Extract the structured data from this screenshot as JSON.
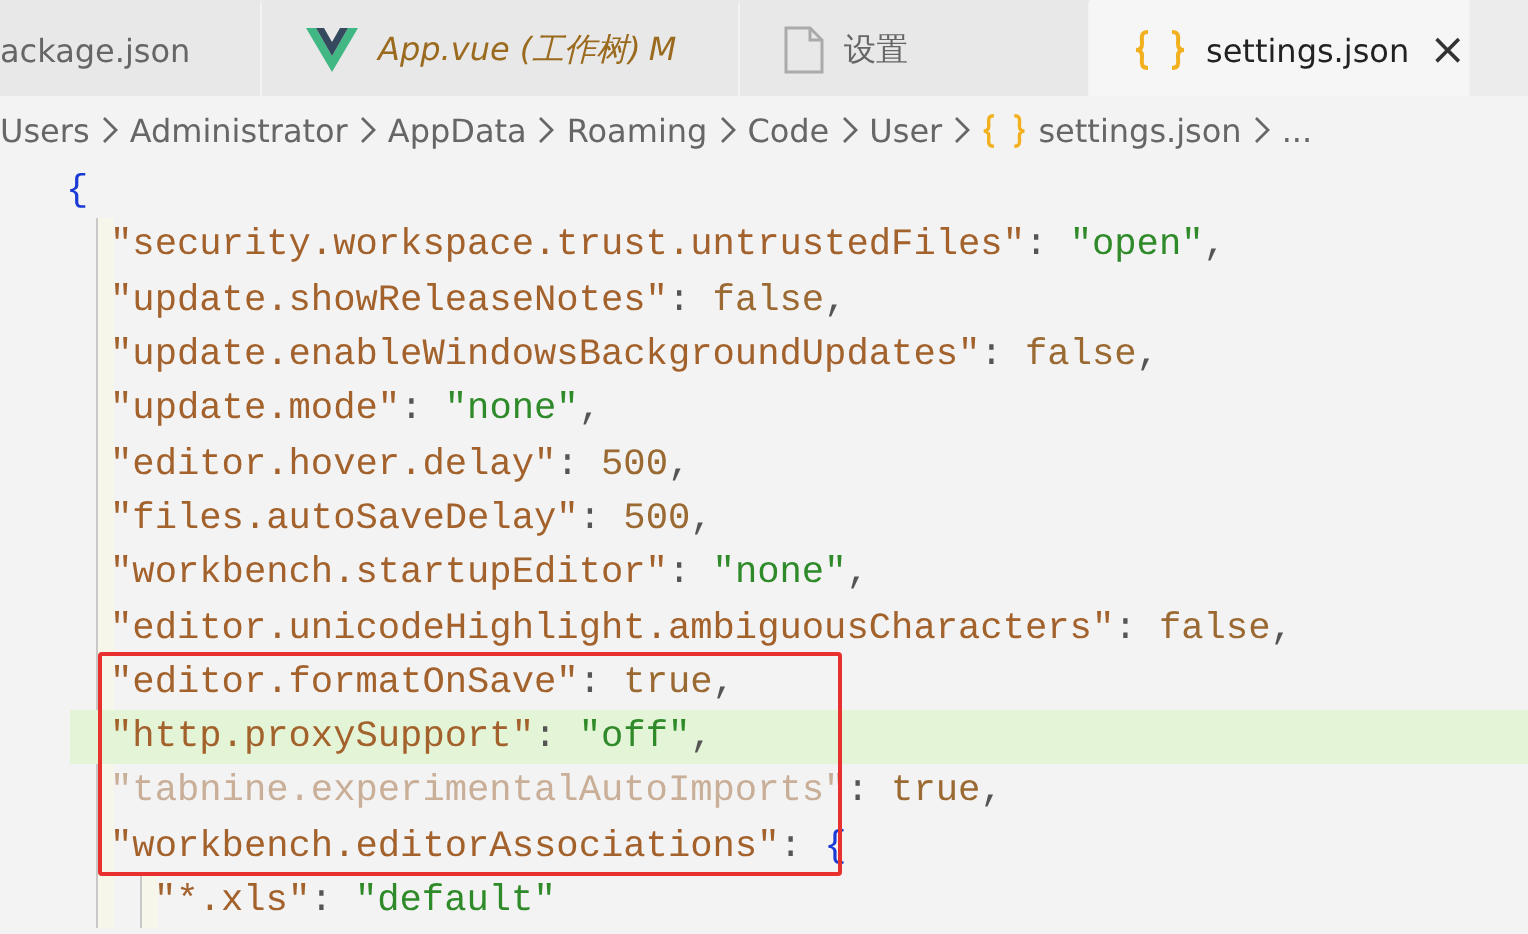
{
  "tabs": [
    {
      "kind": "json",
      "label": "ackage.json",
      "selected": false,
      "modified": false
    },
    {
      "kind": "vue",
      "label": "App.vue (工作树)",
      "decoration": "M",
      "selected": false,
      "modified": true
    },
    {
      "kind": "file",
      "label": "设置",
      "selected": false,
      "modified": false
    },
    {
      "kind": "settings",
      "label": "settings.json",
      "close": "×",
      "selected": true,
      "modified": false
    }
  ],
  "breadcrumbs": [
    {
      "kind": "folder",
      "label": "Users"
    },
    {
      "kind": "folder",
      "label": "Administrator"
    },
    {
      "kind": "folder",
      "label": "AppData"
    },
    {
      "kind": "folder",
      "label": "Roaming"
    },
    {
      "kind": "folder",
      "label": "Code"
    },
    {
      "kind": "folder",
      "label": "User"
    },
    {
      "kind": "json",
      "label": "settings.json"
    },
    {
      "kind": "more",
      "label": "..."
    }
  ],
  "code": {
    "highlighted": false,
    "boxed": false,
    "tokens": [
      {
        "kind": "brace",
        "text": "{"
      }
    ],
    "children": [
      {
        "highlighted": false,
        "boxed": false,
        "tokens": [
          {
            "kind": "key",
            "text": "\"security.workspace.trust.untrustedFiles\""
          },
          {
            "kind": "punct",
            "text": ": "
          },
          {
            "kind": "string",
            "text": "\"open\""
          },
          {
            "kind": "punct",
            "text": ","
          }
        ]
      },
      {
        "highlighted": false,
        "boxed": false,
        "tokens": [
          {
            "kind": "key",
            "text": "\"update.showReleaseNotes\""
          },
          {
            "kind": "punct",
            "text": ": "
          },
          {
            "kind": "literal",
            "text": "false"
          },
          {
            "kind": "punct",
            "text": ","
          }
        ]
      },
      {
        "highlighted": false,
        "boxed": false,
        "tokens": [
          {
            "kind": "key",
            "text": "\"update.enableWindowsBackgroundUpdates\""
          },
          {
            "kind": "punct",
            "text": ": "
          },
          {
            "kind": "literal",
            "text": "false"
          },
          {
            "kind": "punct",
            "text": ","
          }
        ]
      },
      {
        "highlighted": false,
        "boxed": false,
        "tokens": [
          {
            "kind": "key",
            "text": "\"update.mode\""
          },
          {
            "kind": "punct",
            "text": ": "
          },
          {
            "kind": "string",
            "text": "\"none\""
          },
          {
            "kind": "punct",
            "text": ","
          }
        ]
      },
      {
        "highlighted": false,
        "boxed": false,
        "tokens": [
          {
            "kind": "key",
            "text": "\"editor.hover.delay\""
          },
          {
            "kind": "punct",
            "text": ": "
          },
          {
            "kind": "literal",
            "text": "500"
          },
          {
            "kind": "punct",
            "text": ","
          }
        ]
      },
      {
        "highlighted": false,
        "boxed": false,
        "tokens": [
          {
            "kind": "key",
            "text": "\"files.autoSaveDelay\""
          },
          {
            "kind": "punct",
            "text": ": "
          },
          {
            "kind": "literal",
            "text": "500"
          },
          {
            "kind": "punct",
            "text": ","
          }
        ]
      },
      {
        "highlighted": false,
        "boxed": false,
        "tokens": [
          {
            "kind": "key",
            "text": "\"workbench.startupEditor\""
          },
          {
            "kind": "punct",
            "text": ": "
          },
          {
            "kind": "string",
            "text": "\"none\""
          },
          {
            "kind": "punct",
            "text": ","
          }
        ]
      },
      {
        "highlighted": false,
        "boxed": false,
        "tokens": [
          {
            "kind": "key",
            "text": "\"editor.unicodeHighlight.ambiguousCharacters\""
          },
          {
            "kind": "punct",
            "text": ": "
          },
          {
            "kind": "literal",
            "text": "false"
          },
          {
            "kind": "punct",
            "text": ","
          }
        ]
      },
      {
        "highlighted": false,
        "boxed": true,
        "tokens": [
          {
            "kind": "key",
            "text": "\"editor.formatOnSave\""
          },
          {
            "kind": "punct",
            "text": ": "
          },
          {
            "kind": "literal",
            "text": "true"
          },
          {
            "kind": "punct",
            "text": ","
          }
        ]
      },
      {
        "highlighted": true,
        "boxed": true,
        "tokens": [
          {
            "kind": "key",
            "text": "\"http.proxySupport\""
          },
          {
            "kind": "punct",
            "text": ": "
          },
          {
            "kind": "string",
            "text": "\"off\""
          },
          {
            "kind": "punct",
            "text": ","
          }
        ]
      },
      {
        "highlighted": false,
        "boxed": true,
        "tokens": [
          {
            "kind": "dim",
            "text": "\"tabnine.experimentalAutoImports\""
          },
          {
            "kind": "punct",
            "text": ": "
          },
          {
            "kind": "literal",
            "text": "true"
          },
          {
            "kind": "punct",
            "text": ","
          }
        ]
      },
      {
        "highlighted": false,
        "boxed": true,
        "tokens": [
          {
            "kind": "key",
            "text": "\"workbench.editorAssociations\""
          },
          {
            "kind": "punct",
            "text": ": "
          },
          {
            "kind": "brace",
            "text": "{"
          }
        ],
        "children": [
          {
            "highlighted": false,
            "boxed": false,
            "tokens": [
              {
                "kind": "key",
                "text": "\"*.xls\""
              },
              {
                "kind": "punct",
                "text": ": "
              },
              {
                "kind": "string",
                "text": "\"default\""
              }
            ]
          }
        ]
      }
    ]
  }
}
